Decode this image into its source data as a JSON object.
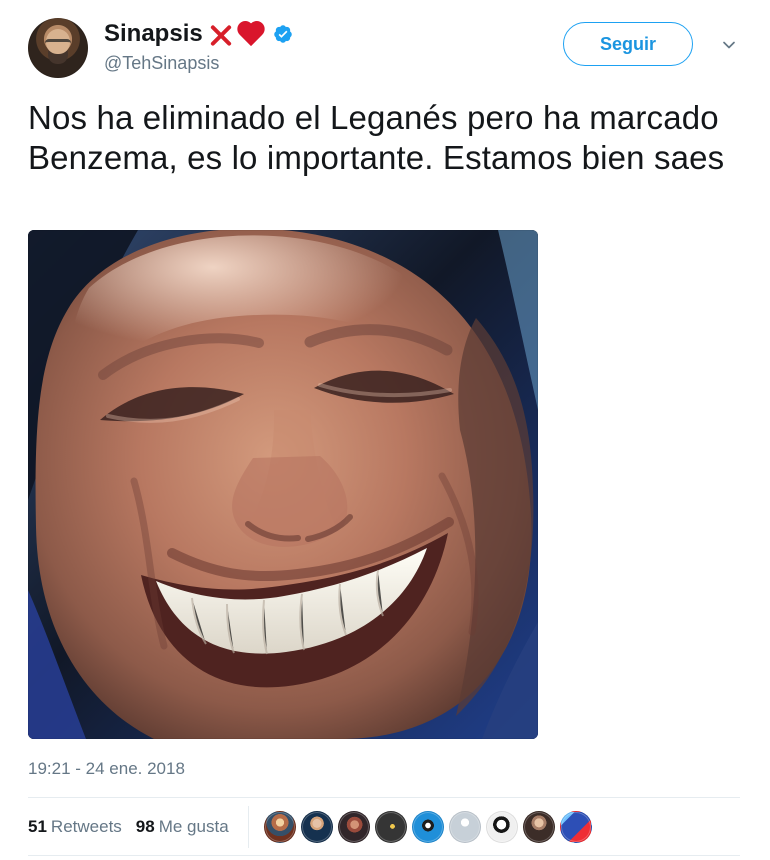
{
  "tweet": {
    "display_name": "Sinapsis",
    "handle": "@TehSinapsis",
    "follow_label": "Seguir",
    "text": "Nos ha eliminado el Leganés pero ha marcado Benzema, es lo importante. Estamos bien saes",
    "timestamp": "19:21 - 24 ene. 2018",
    "retweets_count": "51",
    "retweets_label": "Retweets",
    "likes_count": "98",
    "likes_label": "Me gusta",
    "name_emojis": [
      "cross-mark-icon",
      "red-heart-icon"
    ],
    "verified_icon": "verified-badge-icon",
    "menu_icon": "chevron-down-icon"
  },
  "liker_avatars": [
    "liker-avatar-1",
    "liker-avatar-2",
    "liker-avatar-3",
    "liker-avatar-4",
    "liker-avatar-5",
    "liker-avatar-6",
    "liker-avatar-7",
    "liker-avatar-8",
    "liker-avatar-9"
  ],
  "colors": {
    "accent": "#1da1f2",
    "accent_text": "#1b95e0",
    "muted": "#657786",
    "text": "#14171a",
    "divider": "#e6ecf0"
  }
}
